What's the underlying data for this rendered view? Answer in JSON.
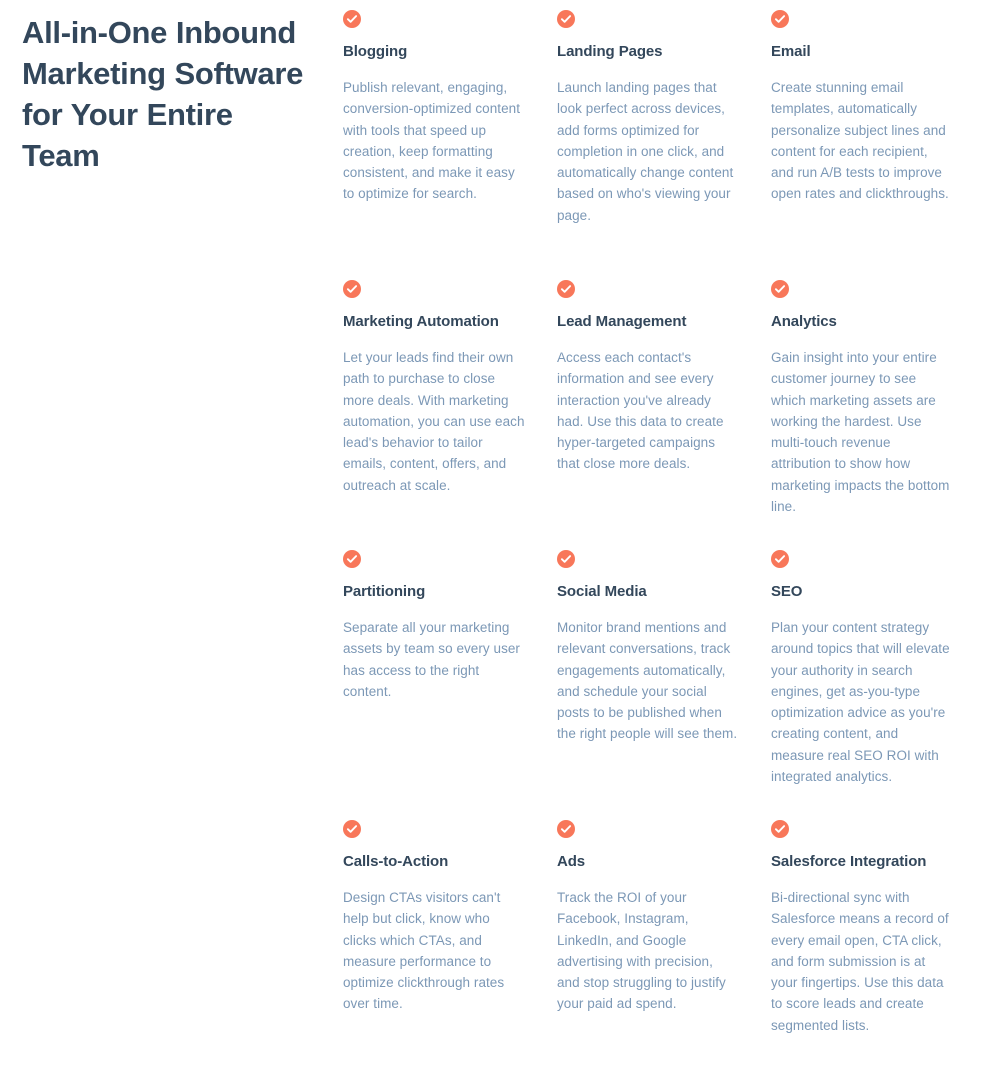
{
  "headline": "All-in-One Inbound Marketing Software for Your Entire Team",
  "colors": {
    "heading": "#33475b",
    "body_text": "#7c98b6",
    "icon_background": "#f8775a",
    "icon_check": "#ffffff",
    "page_background": "#ffffff"
  },
  "icons": {
    "check": "check-circle-icon"
  },
  "features": [
    {
      "title": "Blogging",
      "description": "Publish relevant, engaging, conversion-optimized content with tools that speed up creation, keep formatting consistent, and make it easy to optimize for search."
    },
    {
      "title": "Landing Pages",
      "description": "Launch landing pages that look perfect across devices, add forms optimized for completion in one click, and automatically change content based on who's viewing your page."
    },
    {
      "title": "Email",
      "description": "Create stunning email templates, automatically personalize subject lines and content for each recipient, and run A/B tests to improve open rates and clickthroughs."
    },
    {
      "title": "Marketing Automation",
      "description": "Let your leads find their own path to purchase to close more deals. With marketing automation, you can use each lead's behavior to tailor emails, content, offers, and outreach at scale."
    },
    {
      "title": "Lead Management",
      "description": "Access each contact's information and see every interaction you've already had. Use this data to create hyper-targeted campaigns that close more deals."
    },
    {
      "title": "Analytics",
      "description": "Gain insight into your entire customer journey to see which marketing assets are working the hardest. Use multi-touch revenue attribution to show how marketing impacts the bottom line."
    },
    {
      "title": "Partitioning",
      "description": "Separate all your marketing assets by team so every user has access to the right content."
    },
    {
      "title": "Social Media",
      "description": "Monitor brand mentions and relevant conversations, track engagements automatically, and schedule your social posts to be published when the right people will see them."
    },
    {
      "title": "SEO",
      "description": "Plan your content strategy around topics that will elevate your authority in search engines, get as-you-type optimization advice as you're creating content, and measure real SEO ROI with integrated analytics."
    },
    {
      "title": "Calls-to-Action",
      "description": "Design CTAs visitors can't help but click, know who clicks which CTAs, and measure performance to optimize clickthrough rates over time."
    },
    {
      "title": "Ads",
      "description": "Track the ROI of your Facebook, Instagram, LinkedIn, and Google advertising with precision, and stop struggling to justify your paid ad spend."
    },
    {
      "title": "Salesforce Integration",
      "description": "Bi-directional sync with Salesforce means a record of every email open, CTA click, and form submission is at your fingertips. Use this data to score leads and create segmented lists."
    }
  ]
}
